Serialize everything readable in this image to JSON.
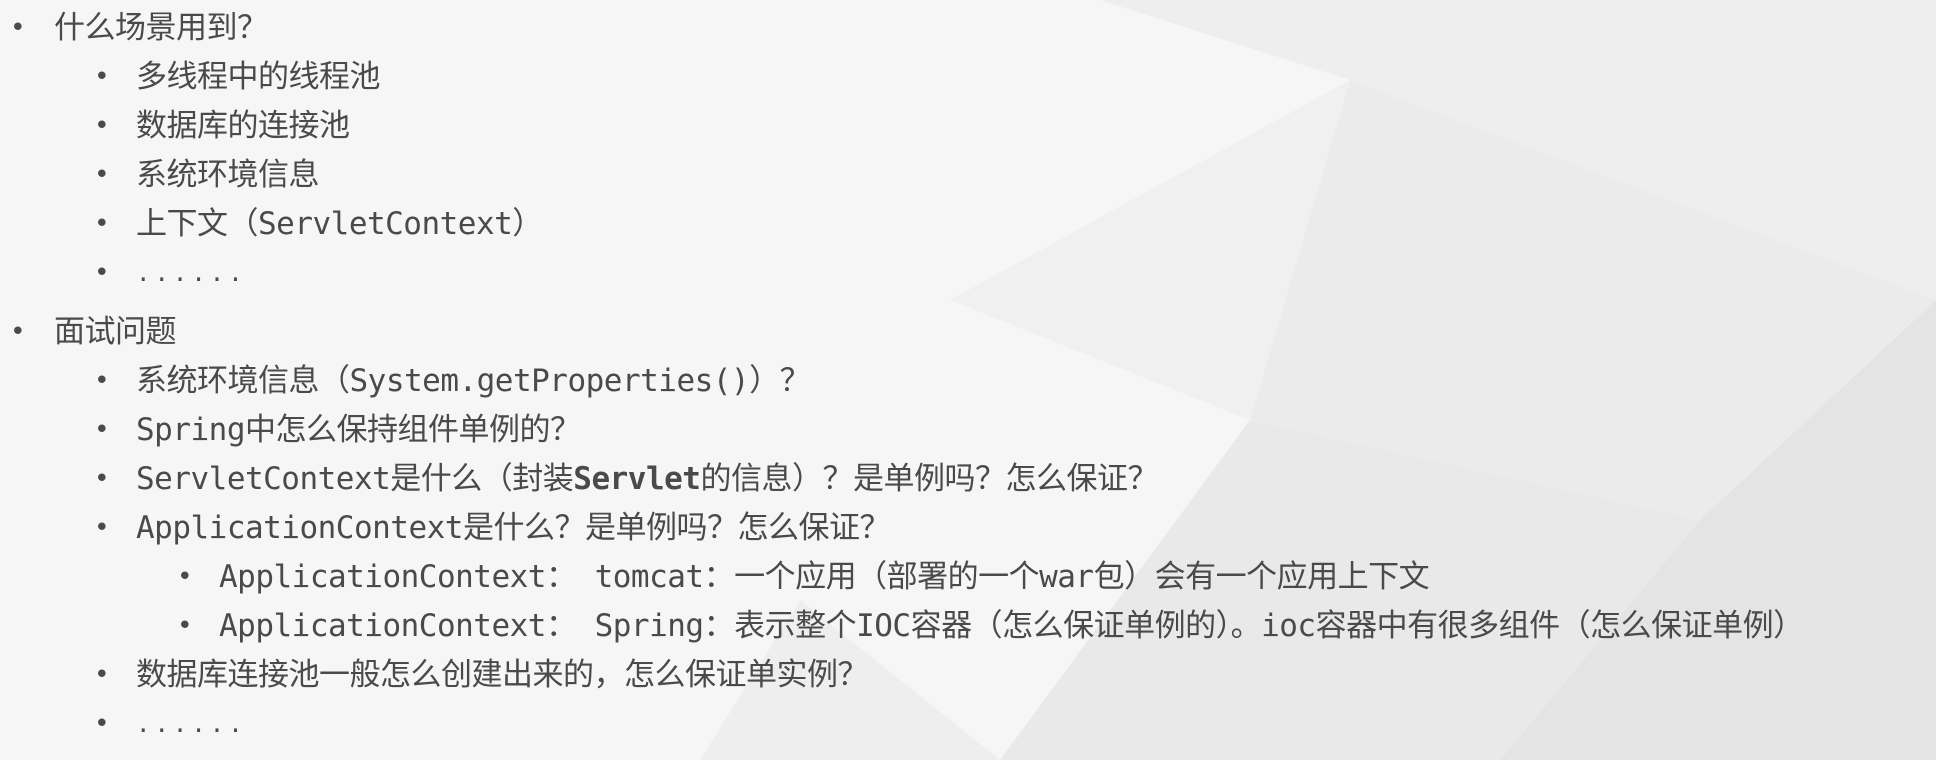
{
  "bullet_glyph": "•",
  "items": [
    {
      "text": "什么场景用到？"
    },
    {
      "text": "多线程中的线程池"
    },
    {
      "text": "数据库的连接池"
    },
    {
      "text": "系统环境信息"
    },
    {
      "text": "上下文（ServletContext）"
    },
    {
      "text": "......"
    },
    {
      "text": "面试问题"
    },
    {
      "text": "系统环境信息（System.getProperties()）？"
    },
    {
      "text": "Spring中怎么保持组件单例的？"
    },
    {
      "text_before": "ServletContext是什么（封装",
      "text_bold": "Servlet",
      "text_after": "的信息）？是单例吗？怎么保证？"
    },
    {
      "text": "ApplicationContext是什么？是单例吗？怎么保证？"
    },
    {
      "text": "ApplicationContext： tomcat：一个应用（部署的一个war包）会有一个应用上下文"
    },
    {
      "text": "ApplicationContext： Spring：表示整个IOC容器（怎么保证单例的）。ioc容器中有很多组件（怎么保证单例）"
    },
    {
      "text": "数据库连接池一般怎么创建出来的，怎么保证单实例？"
    },
    {
      "text": "......"
    }
  ]
}
